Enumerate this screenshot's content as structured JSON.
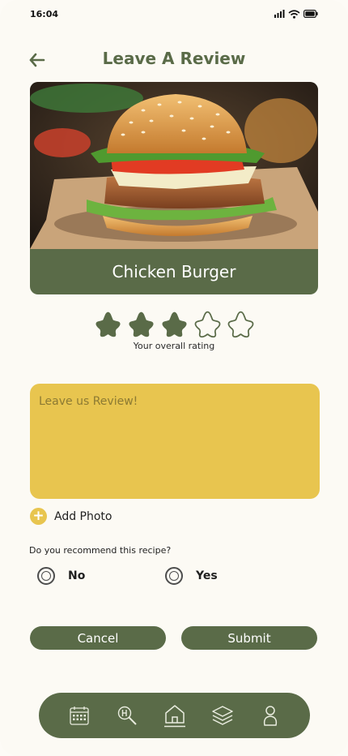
{
  "status_bar": {
    "time": "16:04"
  },
  "header": {
    "title": "Leave A Review",
    "back_icon": "arrow-left-icon"
  },
  "item": {
    "name": "Chicken Burger",
    "image": "chicken-burger-photo"
  },
  "rating": {
    "value": 3,
    "max": 5,
    "label": "Your overall rating"
  },
  "review": {
    "placeholder": "Leave us Review!",
    "value": ""
  },
  "add_photo": {
    "label": "Add Photo"
  },
  "recommend": {
    "question": "Do you recommend this recipe?",
    "options": [
      "No",
      "Yes"
    ],
    "selected": null
  },
  "actions": {
    "cancel": "Cancel",
    "submit": "Submit"
  },
  "nav": {
    "items": [
      "calendar-icon",
      "search-recipe-icon",
      "home-icon",
      "layers-icon",
      "profile-icon"
    ],
    "active": "home-icon"
  },
  "colors": {
    "primary": "#5a6b48",
    "accent": "#e8c54f",
    "background": "#fcfaf4"
  }
}
